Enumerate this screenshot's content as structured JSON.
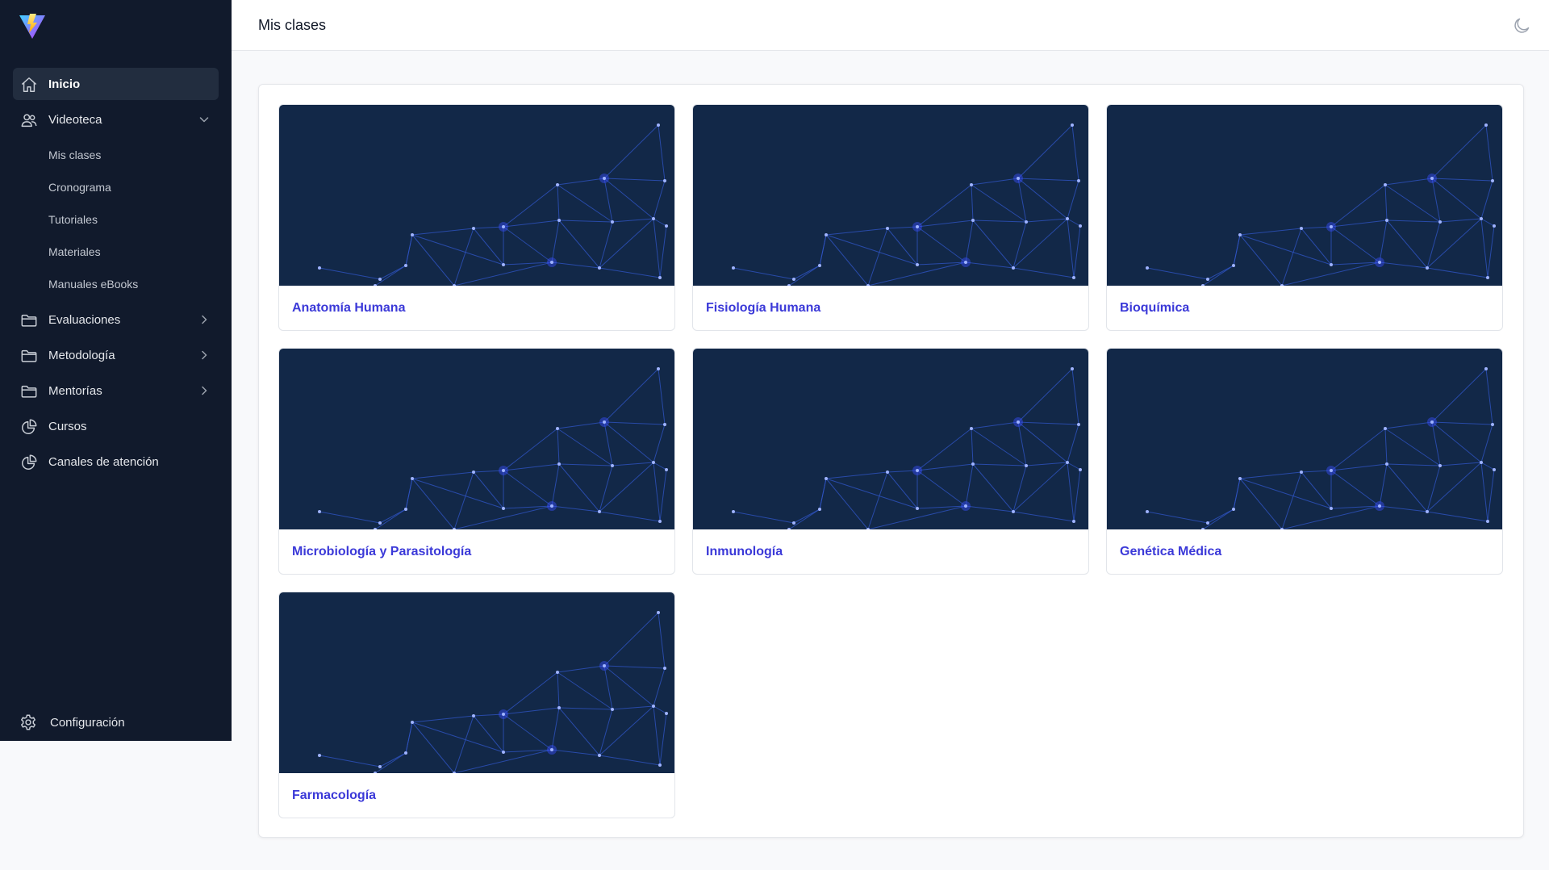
{
  "sidebar": {
    "items": [
      {
        "label": "Inicio",
        "icon": "home-icon"
      },
      {
        "label": "Videoteca",
        "icon": "users-icon"
      },
      {
        "label": "Evaluaciones",
        "icon": "folder-icon"
      },
      {
        "label": "Metodología",
        "icon": "folder-icon"
      },
      {
        "label": "Mentorías",
        "icon": "folder-icon"
      },
      {
        "label": "Cursos",
        "icon": "pie-chart-icon"
      },
      {
        "label": "Canales de atención",
        "icon": "pie-chart-icon"
      }
    ],
    "videoteca_subitems": [
      "Mis clases",
      "Cronograma",
      "Tutoriales",
      "Materiales",
      "Manuales eBooks"
    ],
    "config_label": "Configuración"
  },
  "header": {
    "title": "Mis clases"
  },
  "courses": [
    {
      "name": "Anatomía Humana"
    },
    {
      "name": "Fisiología Humana"
    },
    {
      "name": "Bioquímica"
    },
    {
      "name": "Microbiología y Parasitología"
    },
    {
      "name": "Inmunología"
    },
    {
      "name": "Genética Médica"
    },
    {
      "name": "Farmacología"
    }
  ],
  "colors": {
    "sidebar_bg": "#111a2c",
    "accent": "#3b39d8",
    "thumb_bg": "#122848"
  }
}
